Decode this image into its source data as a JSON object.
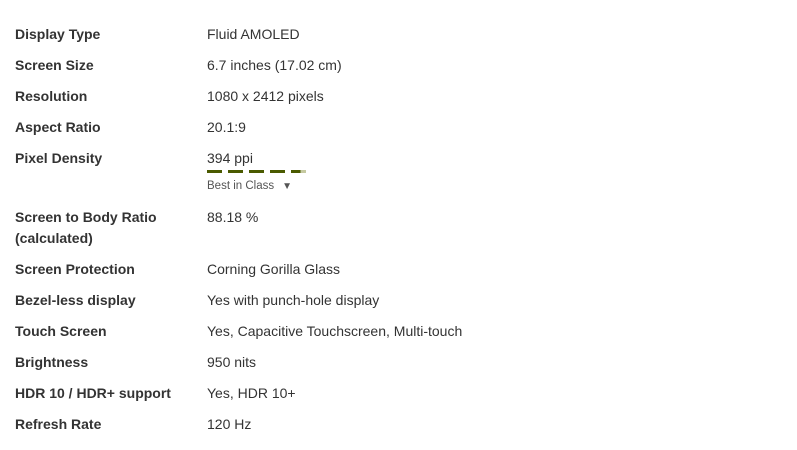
{
  "specs": [
    {
      "label": "Display Type",
      "value": "Fluid AMOLED"
    },
    {
      "label": "Screen Size",
      "value": "6.7 inches (17.02 cm)"
    },
    {
      "label": "Resolution",
      "value": "1080 x 2412 pixels"
    },
    {
      "label": "Aspect Ratio",
      "value": "20.1:9"
    },
    {
      "label": "Pixel Density",
      "value": "394 ppi",
      "rating_fraction": 0.93,
      "rating_text": "Best in Class",
      "rating_caret": "▼"
    },
    {
      "label": "Screen to Body Ratio (calculated)",
      "value": "88.18 %"
    },
    {
      "label": "Screen Protection",
      "value": "Corning Gorilla Glass"
    },
    {
      "label": "Bezel-less display",
      "value": "Yes with punch-hole display"
    },
    {
      "label": "Touch Screen",
      "value": "Yes, Capacitive Touchscreen, Multi-touch"
    },
    {
      "label": "Brightness",
      "value": "950 nits"
    },
    {
      "label": "HDR 10 / HDR+ support",
      "value": "Yes, HDR 10+"
    },
    {
      "label": "Refresh Rate",
      "value": "120 Hz"
    }
  ],
  "colors": {
    "rating_bar": "#4a5a00",
    "text": "#333333"
  }
}
